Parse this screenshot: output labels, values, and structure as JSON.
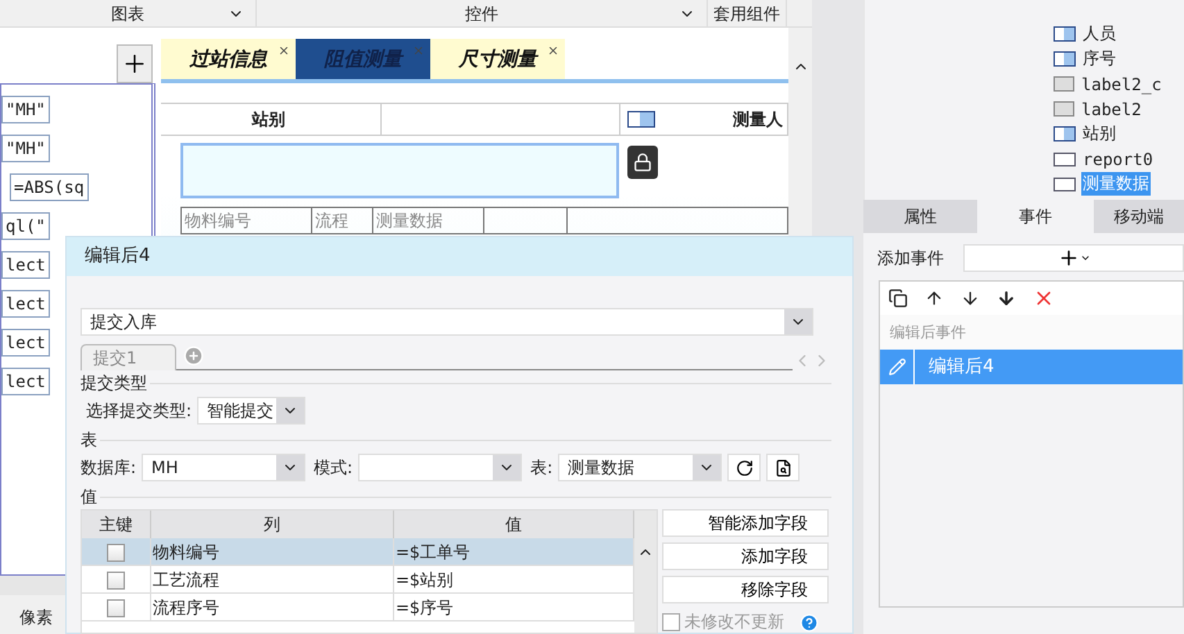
{
  "toolbar": {
    "tabs": [
      {
        "label": "图表"
      },
      {
        "label": "控件"
      },
      {
        "label": "套用组件"
      }
    ]
  },
  "formula_column": {
    "cells": [
      {
        "text": "\"MH\"",
        "indent": false
      },
      {
        "text": "\"MH\"",
        "indent": false
      },
      {
        "text": "=ABS(sq",
        "indent": true
      },
      {
        "text": "ql(\"",
        "indent": false
      },
      {
        "text": "lect",
        "indent": false
      },
      {
        "text": "lect",
        "indent": false
      },
      {
        "text": "lect",
        "indent": false
      },
      {
        "text": "lect",
        "indent": false
      }
    ],
    "unit": "像素"
  },
  "canvas": {
    "tabs": [
      {
        "label": "过站信息",
        "selected": false
      },
      {
        "label": "阻值测量",
        "selected": true
      },
      {
        "label": "尺寸测量",
        "selected": false
      }
    ],
    "header_cells": [
      "站别",
      "测量人"
    ],
    "table_headers": [
      "物料编号",
      "流程",
      "测量数据"
    ]
  },
  "dialog": {
    "title": "编辑后4",
    "action": "提交入库",
    "tabs": [
      {
        "label": "提交1",
        "selected": true
      }
    ],
    "submit_section": "提交类型",
    "submit_type_label": "选择提交类型:",
    "submit_type": "智能提交",
    "table_section": "表",
    "database_label": "数据库:",
    "database": "MH",
    "schema_label": "模式:",
    "table_label": "表:",
    "table": "测量数据",
    "value_section": "值",
    "columns": [
      "主键",
      "列",
      "值"
    ],
    "rows": [
      {
        "key": false,
        "column": "物料编号",
        "value": "=$工单号",
        "selected": true
      },
      {
        "key": false,
        "column": "工艺流程",
        "value": "=$站别",
        "selected": false
      },
      {
        "key": false,
        "column": "流程序号",
        "value": "=$序号",
        "selected": false
      }
    ],
    "buttons": [
      "智能添加字段",
      "添加字段",
      "移除字段"
    ],
    "unchanged_option": {
      "label": "未修改不更新",
      "checked": false,
      "disabled": true
    }
  },
  "right_panel": {
    "tree": [
      {
        "label": "人员",
        "kind": "combo",
        "selected": false
      },
      {
        "label": "序号",
        "kind": "combo",
        "selected": false
      },
      {
        "label": "label2_c",
        "kind": "label",
        "selected": false
      },
      {
        "label": "label2",
        "kind": "label",
        "selected": false
      },
      {
        "label": "站别",
        "kind": "combo",
        "selected": false
      },
      {
        "label": "report0",
        "kind": "report",
        "selected": false
      },
      {
        "label": "测量数据",
        "kind": "report",
        "selected": true
      }
    ],
    "tabs": [
      {
        "label": "属性",
        "selected": false
      },
      {
        "label": "事件",
        "selected": true
      },
      {
        "label": "移动端",
        "selected": false
      }
    ],
    "add_event_label": "添加事件",
    "event_group": "编辑后事件",
    "events": [
      {
        "label": "编辑后4",
        "selected": true
      }
    ]
  }
}
